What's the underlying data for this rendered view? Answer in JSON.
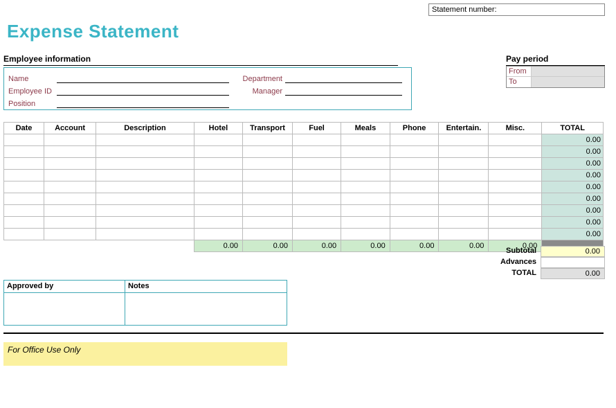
{
  "statement_number_label": "Statement number:",
  "title": "Expense Statement",
  "employee_info": {
    "header": "Employee information",
    "name_label": "Name",
    "employee_id_label": "Employee ID",
    "position_label": "Position",
    "department_label": "Department",
    "manager_label": "Manager"
  },
  "pay_period": {
    "header": "Pay period",
    "from_label": "From",
    "to_label": "To"
  },
  "table": {
    "headers": {
      "date": "Date",
      "account": "Account",
      "description": "Description",
      "hotel": "Hotel",
      "transport": "Transport",
      "fuel": "Fuel",
      "meals": "Meals",
      "phone": "Phone",
      "entertain": "Entertain.",
      "misc": "Misc.",
      "total": "TOTAL"
    },
    "row_totals": [
      "0.00",
      "0.00",
      "0.00",
      "0.00",
      "0.00",
      "0.00",
      "0.00",
      "0.00",
      "0.00"
    ],
    "col_totals": {
      "hotel": "0.00",
      "transport": "0.00",
      "fuel": "0.00",
      "meals": "0.00",
      "phone": "0.00",
      "entertain": "0.00",
      "misc": "0.00"
    }
  },
  "summary": {
    "subtotal_label": "Subtotal",
    "subtotal_value": "0.00",
    "advances_label": "Advances",
    "advances_value": "",
    "total_label": "TOTAL",
    "total_value": "0.00"
  },
  "approval": {
    "approved_by_label": "Approved by",
    "notes_label": "Notes"
  },
  "office_use_label": "For Office Use Only"
}
